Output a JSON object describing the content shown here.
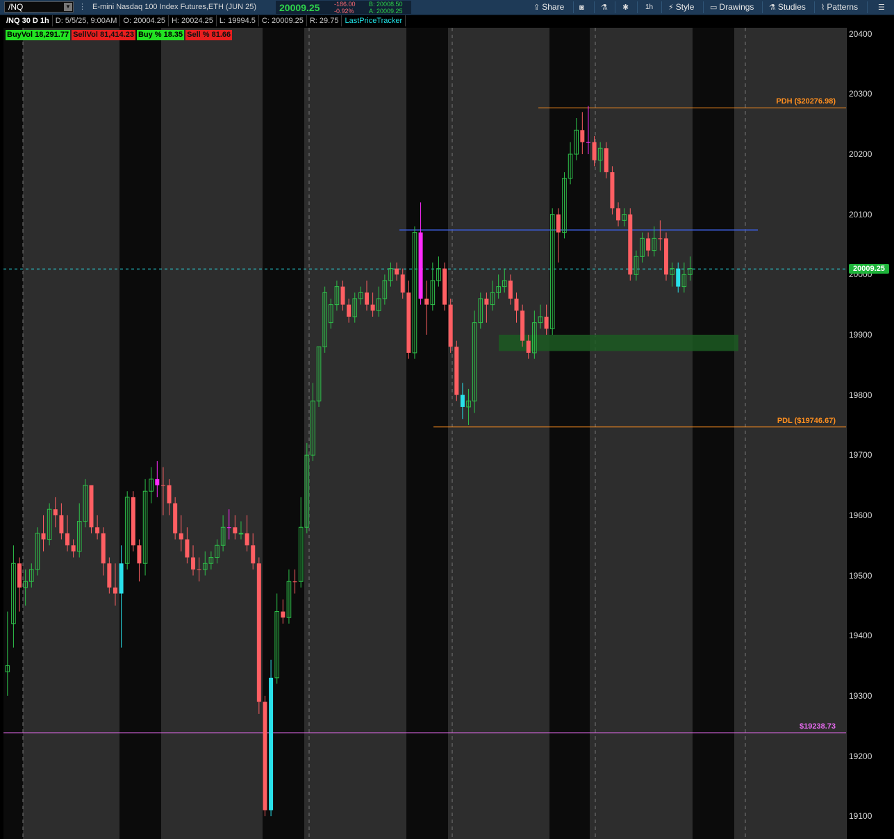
{
  "toolbar": {
    "symbol": "/NQ",
    "description": "E-mini Nasdaq 100 Index Futures,ETH (JUN 25)",
    "last_price": "20009.25",
    "net_change": "-186.00",
    "pct_change": "-0.92%",
    "bid": "B: 20008.50",
    "ask": "A: 20009.25",
    "share_label": "Share",
    "interval_label": "1h",
    "style_label": "Style",
    "drawings_label": "Drawings",
    "studies_label": "Studies",
    "patterns_label": "Patterns",
    "icons": [
      "link-icon",
      "share-icon",
      "camera-icon",
      "flask-icon",
      "gear-icon",
      "style-icon",
      "drawings-icon",
      "studies-icon",
      "patterns-icon",
      "menu-icon"
    ]
  },
  "header": {
    "title": "/NQ 30 D 1h",
    "date": "D: 5/5/25, 9:00AM",
    "open": "O: 20004.25",
    "high": "H: 20024.25",
    "low": "L: 19994.5",
    "close": "C: 20009.25",
    "range": "R: 29.75",
    "study": "LastPriceTracker"
  },
  "volume_labels": {
    "buy_vol": "BuyVol 18,291.77",
    "sell_vol": "SellVol 81,414.23",
    "buy_pct": "Buy % 18.35",
    "sell_pct": "Sell % 81.66"
  },
  "levels": {
    "pdh": "PDH ($20276.98)",
    "pdl": "PDL ($19746.67)",
    "other": "$19238.73",
    "last_tag": "20009.25"
  },
  "colors": {
    "up": "#2ec24a",
    "down": "#ff5f63",
    "magenta": "#ff2bff",
    "cyan": "#29e1ea",
    "pdh": "#ff8f1f",
    "pink": "#e86bf0",
    "blue_line": "#3b5bd6",
    "session_dark": "#0b0b0b",
    "session_light": "#2d2d2d"
  },
  "axis": {
    "ticks": [
      "20400",
      "20300",
      "20200",
      "20100",
      "20000",
      "19900",
      "19800",
      "19700",
      "19600",
      "19500",
      "19400",
      "19300",
      "19200",
      "19100"
    ]
  },
  "chart_data": {
    "type": "candlestick",
    "symbol": "/NQ",
    "interval": "1h",
    "ylim": [
      19090,
      20415
    ],
    "grid": false,
    "horizontal_levels": [
      {
        "label": "PDH ($20276.98)",
        "value": 20276.98
      },
      {
        "label": "PDL ($19746.67)",
        "value": 19746.67
      },
      {
        "label": "$19238.73",
        "value": 19238.73
      },
      {
        "label": "",
        "value": 20074
      },
      {
        "label": "20009.25",
        "value": 20009.25
      }
    ],
    "zone": {
      "low": 19873,
      "high": 19900
    },
    "candles": [
      [
        19340,
        19350,
        19300,
        19440,
        "u"
      ],
      [
        19420,
        19520,
        19380,
        19550,
        "u"
      ],
      [
        19520,
        19480,
        19440,
        19530,
        "d"
      ],
      [
        19480,
        19490,
        19450,
        19510,
        "u"
      ],
      [
        19490,
        19510,
        19480,
        19520,
        "u"
      ],
      [
        19510,
        19570,
        19500,
        19580,
        "u"
      ],
      [
        19570,
        19560,
        19540,
        19600,
        "d"
      ],
      [
        19560,
        19610,
        19550,
        19620,
        "u"
      ],
      [
        19610,
        19600,
        19580,
        19630,
        "d"
      ],
      [
        19600,
        19570,
        19560,
        19620,
        "d"
      ],
      [
        19570,
        19550,
        19540,
        19600,
        "d"
      ],
      [
        19550,
        19540,
        19530,
        19560,
        "d"
      ],
      [
        19540,
        19590,
        19530,
        19620,
        "u"
      ],
      [
        19590,
        19650,
        19580,
        19660,
        "u"
      ],
      [
        19650,
        19580,
        19570,
        19650,
        "d"
      ],
      [
        19580,
        19570,
        19560,
        19600,
        "d"
      ],
      [
        19570,
        19520,
        19500,
        19580,
        "d"
      ],
      [
        19520,
        19480,
        19470,
        19530,
        "d"
      ],
      [
        19480,
        19470,
        19450,
        19520,
        "d"
      ],
      [
        19470,
        19520,
        19380,
        19550,
        "c"
      ],
      [
        19520,
        19630,
        19510,
        19640,
        "u"
      ],
      [
        19630,
        19550,
        19540,
        19640,
        "d"
      ],
      [
        19550,
        19520,
        19490,
        19560,
        "d"
      ],
      [
        19520,
        19640,
        19500,
        19660,
        "u"
      ],
      [
        19640,
        19660,
        19620,
        19680,
        "u"
      ],
      [
        19660,
        19650,
        19630,
        19690,
        "m"
      ],
      [
        19650,
        19650,
        19600,
        19680,
        "d"
      ],
      [
        19650,
        19620,
        19600,
        19660,
        "d"
      ],
      [
        19620,
        19570,
        19560,
        19630,
        "d"
      ],
      [
        19570,
        19560,
        19540,
        19600,
        "d"
      ],
      [
        19560,
        19530,
        19520,
        19580,
        "d"
      ],
      [
        19530,
        19510,
        19500,
        19550,
        "d"
      ],
      [
        19510,
        19510,
        19490,
        19530,
        "d"
      ],
      [
        19510,
        19520,
        19500,
        19540,
        "u"
      ],
      [
        19520,
        19530,
        19510,
        19540,
        "u"
      ],
      [
        19530,
        19550,
        19520,
        19560,
        "u"
      ],
      [
        19550,
        19580,
        19540,
        19600,
        "u"
      ],
      [
        19580,
        19580,
        19560,
        19610,
        "m"
      ],
      [
        19580,
        19570,
        19560,
        19600,
        "d"
      ],
      [
        19570,
        19570,
        19560,
        19590,
        "u"
      ],
      [
        19570,
        19550,
        19540,
        19600,
        "d"
      ],
      [
        19550,
        19520,
        19510,
        19570,
        "d"
      ],
      [
        19520,
        19290,
        19270,
        19530,
        "d"
      ],
      [
        19290,
        19110,
        19100,
        19300,
        "d"
      ],
      [
        19110,
        19330,
        19100,
        19360,
        "c"
      ],
      [
        19330,
        19440,
        19320,
        19470,
        "u"
      ],
      [
        19440,
        19430,
        19420,
        19460,
        "d"
      ],
      [
        19430,
        19490,
        19420,
        19510,
        "u"
      ],
      [
        19490,
        19490,
        19470,
        19510,
        "d"
      ],
      [
        19490,
        19580,
        19480,
        19630,
        "u"
      ],
      [
        19580,
        19700,
        19570,
        19720,
        "u"
      ],
      [
        19700,
        19790,
        19690,
        19820,
        "u"
      ],
      [
        19790,
        19880,
        19780,
        19880,
        "u"
      ],
      [
        19880,
        19970,
        19870,
        19980,
        "u"
      ],
      [
        19920,
        19950,
        19910,
        19960,
        "u"
      ],
      [
        19950,
        19980,
        19940,
        19990,
        "u"
      ],
      [
        19980,
        19950,
        19940,
        19990,
        "d"
      ],
      [
        19950,
        19930,
        19920,
        19960,
        "d"
      ],
      [
        19930,
        19960,
        19920,
        19970,
        "u"
      ],
      [
        19960,
        19970,
        19950,
        19980,
        "u"
      ],
      [
        19970,
        19950,
        19940,
        19990,
        "d"
      ],
      [
        19950,
        19940,
        19930,
        19970,
        "d"
      ],
      [
        19940,
        19960,
        19930,
        19980,
        "u"
      ],
      [
        19960,
        19990,
        19950,
        20000,
        "u"
      ],
      [
        19990,
        20010,
        19980,
        20020,
        "u"
      ],
      [
        20010,
        20000,
        19990,
        20020,
        "d"
      ],
      [
        20000,
        19970,
        19960,
        20010,
        "d"
      ],
      [
        19970,
        19870,
        19860,
        19990,
        "d"
      ],
      [
        19870,
        20070,
        19860,
        20080,
        "u"
      ],
      [
        20070,
        19960,
        19950,
        20120,
        "m"
      ],
      [
        19960,
        19950,
        19900,
        19990,
        "d"
      ],
      [
        19950,
        19990,
        19940,
        20020,
        "u"
      ],
      [
        19990,
        20010,
        19980,
        20030,
        "u"
      ],
      [
        20010,
        19950,
        19940,
        20020,
        "d"
      ],
      [
        19950,
        19880,
        19870,
        19960,
        "d"
      ],
      [
        19880,
        19800,
        19790,
        19890,
        "d"
      ],
      [
        19800,
        19780,
        19760,
        19820,
        "c"
      ],
      [
        19780,
        19790,
        19750,
        19810,
        "u"
      ],
      [
        19790,
        19920,
        19770,
        19940,
        "u"
      ],
      [
        19920,
        19960,
        19910,
        19970,
        "u"
      ],
      [
        19960,
        19950,
        19920,
        19970,
        "d"
      ],
      [
        19950,
        19970,
        19940,
        19990,
        "u"
      ],
      [
        19970,
        19980,
        19960,
        20000,
        "u"
      ],
      [
        19980,
        19990,
        19970,
        20010,
        "u"
      ],
      [
        19990,
        19960,
        19950,
        20000,
        "d"
      ],
      [
        19960,
        19940,
        19920,
        19970,
        "d"
      ],
      [
        19940,
        19890,
        19880,
        19950,
        "d"
      ],
      [
        19890,
        19870,
        19860,
        19900,
        "d"
      ],
      [
        19870,
        19920,
        19860,
        19940,
        "u"
      ],
      [
        19920,
        19930,
        19910,
        19950,
        "u"
      ],
      [
        19930,
        19910,
        19900,
        19950,
        "d"
      ],
      [
        19910,
        20100,
        19900,
        20110,
        "u"
      ],
      [
        20100,
        20070,
        20020,
        20110,
        "d"
      ],
      [
        20070,
        20160,
        20060,
        20170,
        "u"
      ],
      [
        20160,
        20200,
        20150,
        20220,
        "u"
      ],
      [
        20200,
        20240,
        20190,
        20260,
        "u"
      ],
      [
        20240,
        20220,
        20200,
        20270,
        "d"
      ],
      [
        20220,
        20220,
        20200,
        20280,
        "m"
      ],
      [
        20220,
        20190,
        20180,
        20230,
        "d"
      ],
      [
        20190,
        20210,
        20170,
        20220,
        "u"
      ],
      [
        20210,
        20170,
        20160,
        20220,
        "d"
      ],
      [
        20170,
        20110,
        20100,
        20180,
        "d"
      ],
      [
        20110,
        20090,
        20080,
        20120,
        "d"
      ],
      [
        20090,
        20100,
        20080,
        20110,
        "u"
      ],
      [
        20100,
        20000,
        19990,
        20110,
        "d"
      ],
      [
        20000,
        20030,
        19990,
        20040,
        "u"
      ],
      [
        20030,
        20060,
        20020,
        20070,
        "u"
      ],
      [
        20060,
        20040,
        20030,
        20070,
        "d"
      ],
      [
        20040,
        20060,
        20030,
        20080,
        "u"
      ],
      [
        20060,
        20060,
        20040,
        20090,
        "d"
      ],
      [
        20060,
        20000,
        19990,
        20070,
        "d"
      ],
      [
        20000,
        20010,
        19980,
        20020,
        "u"
      ],
      [
        20010,
        19980,
        19970,
        20020,
        "c"
      ],
      [
        19980,
        20000,
        19970,
        20020,
        "u"
      ],
      [
        20000,
        20010,
        19990,
        20030,
        "u"
      ]
    ]
  }
}
